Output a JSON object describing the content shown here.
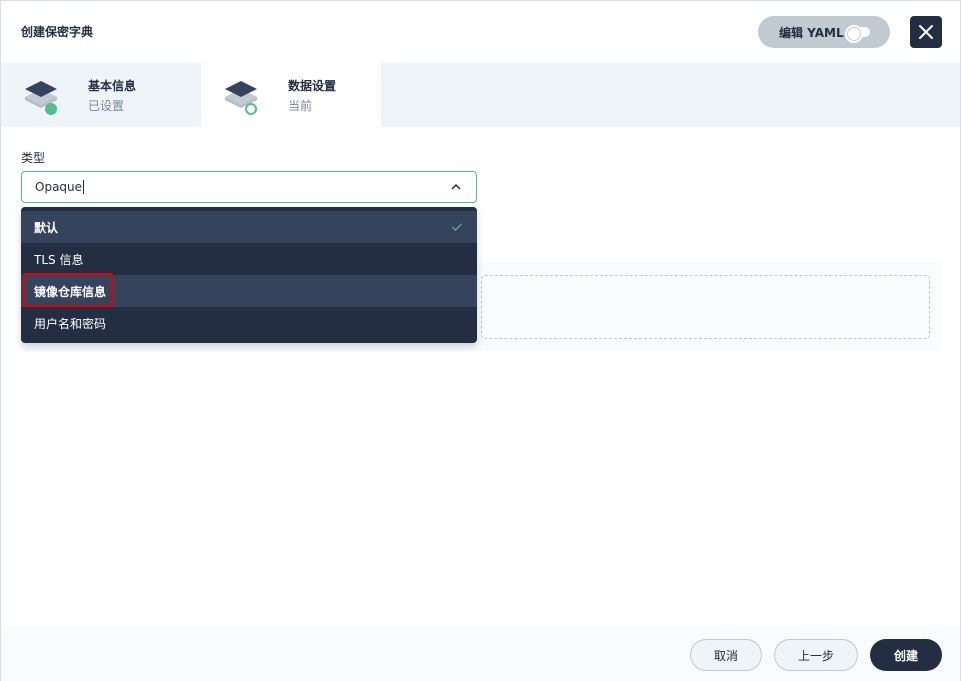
{
  "dialog": {
    "title": "创建保密字典",
    "edit_yaml_label": "编辑 YAML"
  },
  "steps": [
    {
      "title": "基本信息",
      "status": "已设置",
      "icon": "layers-icon"
    },
    {
      "title": "数据设置",
      "status": "当前",
      "icon": "layers-icon"
    }
  ],
  "form": {
    "type_label": "类型",
    "type_value": "Opaque"
  },
  "dropdown": {
    "options": [
      {
        "label": "默认",
        "selected": true
      },
      {
        "label": "TLS 信息",
        "selected": false
      },
      {
        "label": "镜像仓库信息",
        "selected": false
      },
      {
        "label": "用户名和密码",
        "selected": false
      }
    ]
  },
  "footer": {
    "cancel_label": "取消",
    "prev_label": "上一步",
    "create_label": "创建"
  },
  "colors": {
    "primary_dark": "#242e42",
    "accent_green": "#55bc8a",
    "highlight_red": "#e00000"
  }
}
